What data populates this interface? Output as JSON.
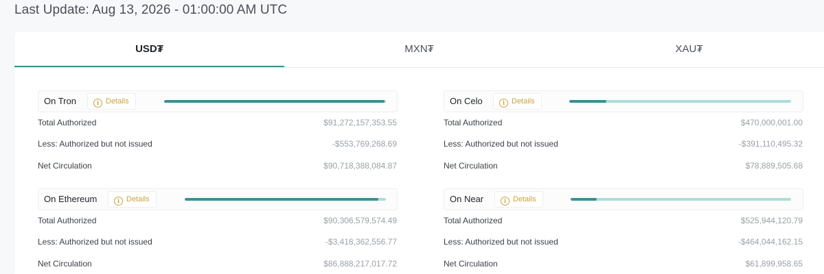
{
  "header": {
    "last_update": "Last Update: Aug 13, 2026 - 01:00:00 AM UTC"
  },
  "tabs": [
    {
      "label": "USD₮",
      "active": true
    },
    {
      "label": "MXN₮",
      "active": false
    },
    {
      "label": "XAU₮",
      "active": false
    }
  ],
  "chains": [
    {
      "name": "On Tron",
      "details_label": "Details",
      "issued_ratio": 0.994,
      "rows": [
        {
          "label": "Total Authorized",
          "value": "$91,272,157,353.55"
        },
        {
          "label": "Less: Authorized but not issued",
          "value": "-$553,769,268.69"
        },
        {
          "label": "Net Circulation",
          "value": "$90,718,388,084.87"
        }
      ]
    },
    {
      "name": "On Celo",
      "details_label": "Details",
      "issued_ratio": 0.168,
      "rows": [
        {
          "label": "Total Authorized",
          "value": "$470,000,001.00"
        },
        {
          "label": "Less: Authorized but not issued",
          "value": "-$391,110,495.32"
        },
        {
          "label": "Net Circulation",
          "value": "$78,889,505.68"
        }
      ]
    },
    {
      "name": "On Ethereum",
      "details_label": "Details",
      "issued_ratio": 0.962,
      "rows": [
        {
          "label": "Total Authorized",
          "value": "$90,306,579,574.49"
        },
        {
          "label": "Less: Authorized but not issued",
          "value": "-$3,418,362,556.77"
        },
        {
          "label": "Net Circulation",
          "value": "$86,888,217,017.72"
        }
      ]
    },
    {
      "name": "On Near",
      "details_label": "Details",
      "issued_ratio": 0.118,
      "rows": [
        {
          "label": "Total Authorized",
          "value": "$525,944,120.79"
        },
        {
          "label": "Less: Authorized but not issued",
          "value": "-$464,044,162.15"
        },
        {
          "label": "Net Circulation",
          "value": "$61,899,958.65"
        }
      ]
    }
  ],
  "colors": {
    "accent": "#3d8f92",
    "bar_track": "#a9dfd7",
    "details_gold": "#c9a23a"
  }
}
